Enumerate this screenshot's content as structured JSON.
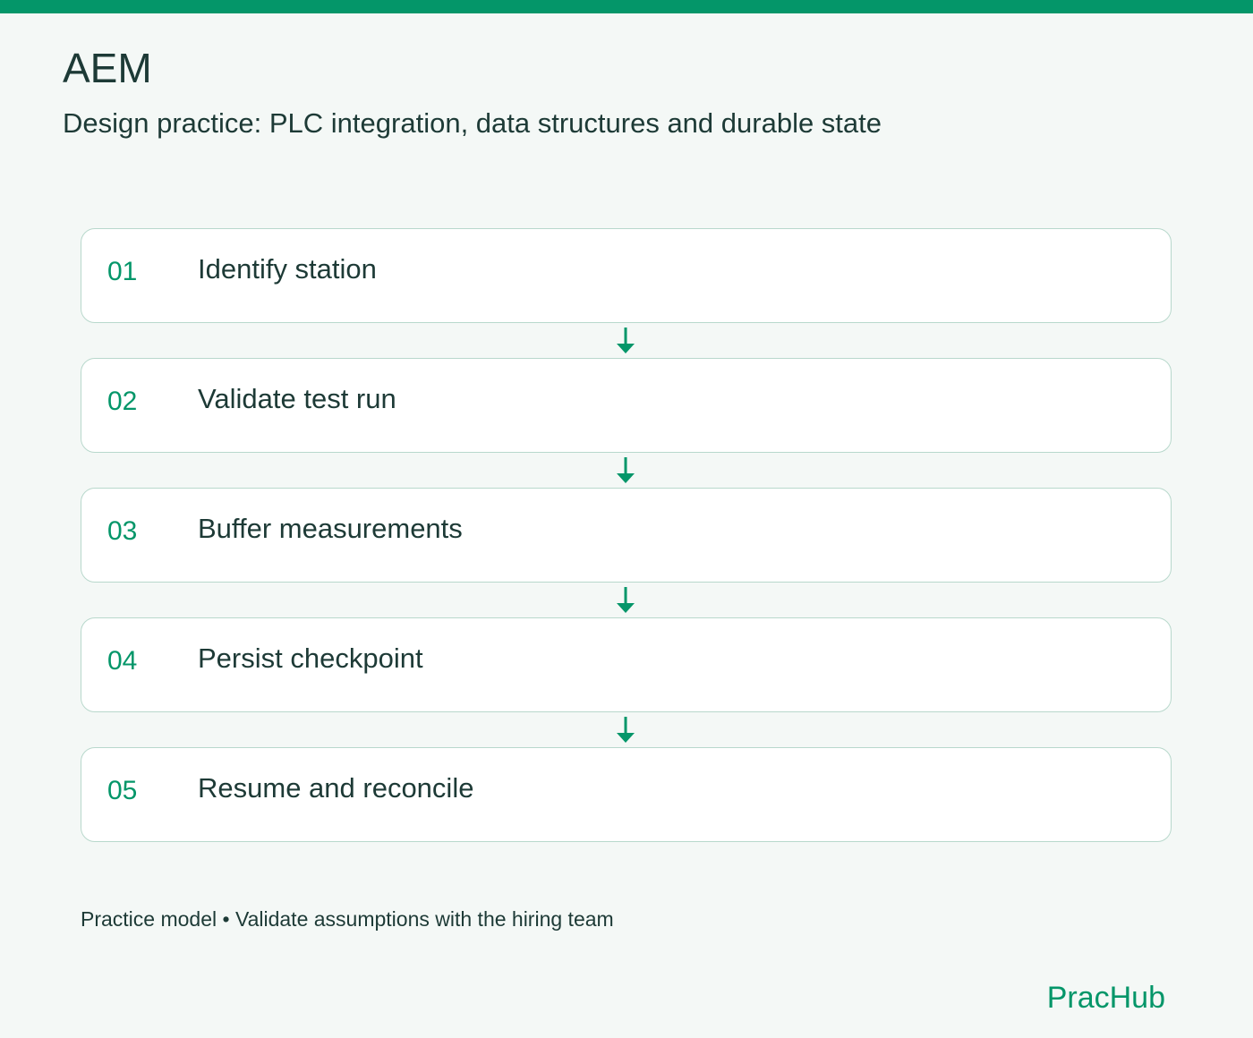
{
  "header": {
    "title": "AEM",
    "subtitle": "Design practice: PLC integration, data structures and durable state"
  },
  "steps": [
    {
      "number": "01",
      "label": "Identify station"
    },
    {
      "number": "02",
      "label": "Validate test run"
    },
    {
      "number": "03",
      "label": "Buffer measurements"
    },
    {
      "number": "04",
      "label": "Persist checkpoint"
    },
    {
      "number": "05",
      "label": "Resume and reconcile"
    }
  ],
  "footer": {
    "note": "Practice model • Validate assumptions with the hiring team",
    "brand": "PracHub"
  },
  "colors": {
    "accent": "#049669",
    "text": "#1d3a36",
    "background": "#f4f8f6",
    "card_border": "#b8d8cc"
  },
  "icons": {
    "connector": "arrow-down-icon"
  }
}
